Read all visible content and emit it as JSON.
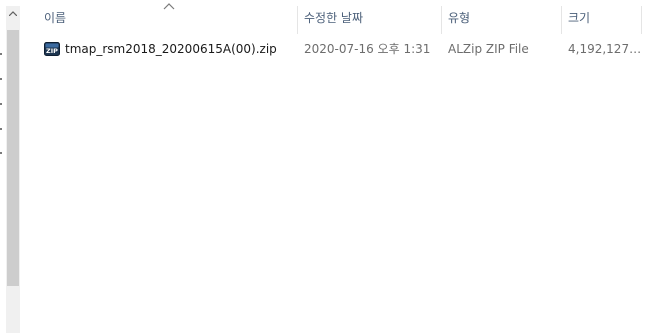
{
  "columns": {
    "name": "이름",
    "date": "수정한 날짜",
    "type": "유형",
    "size": "크기"
  },
  "sort": {
    "column": "name",
    "direction": "ascending"
  },
  "files": [
    {
      "name": "tmap_rsm2018_20200615A(00).zip",
      "date": "2020-07-16 오후 1:31",
      "type": "ALZip ZIP File",
      "size": "4,192,127…",
      "icon": "zip-file-icon",
      "icon_text": "ZIP"
    }
  ]
}
